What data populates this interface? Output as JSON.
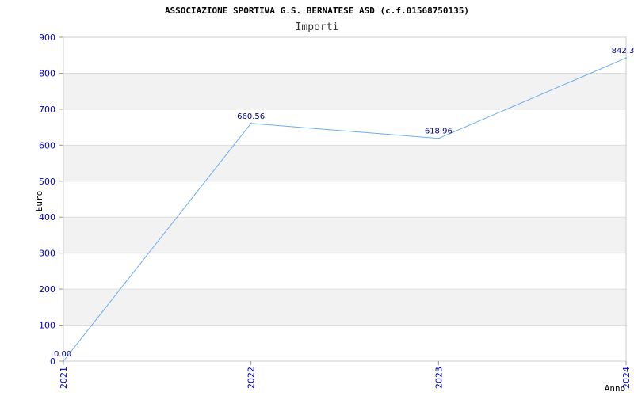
{
  "chart_data": {
    "type": "line",
    "title": "ASSOCIAZIONE SPORTIVA G.S. BERNATESE ASD (c.f.01568750135)",
    "subtitle": "Importi",
    "xlabel": "Anno",
    "ylabel": "Euro",
    "categories": [
      "2021",
      "2022",
      "2023",
      "2024"
    ],
    "series": [
      {
        "values": [
          0.0,
          660.56,
          618.96,
          842.3
        ]
      }
    ],
    "data_labels": [
      "0.00",
      "660.56",
      "618.96",
      "842.3"
    ],
    "ylim": [
      0,
      900
    ],
    "yticks": [
      "0",
      "100",
      "200",
      "300",
      "400",
      "500",
      "600",
      "700",
      "800",
      "900"
    ],
    "grid": "horizontal alternating bands",
    "line_color": "#6aaef0",
    "band_color": "#f2f2f2",
    "tick_color": "#0000cc",
    "label_color": "#000080"
  }
}
